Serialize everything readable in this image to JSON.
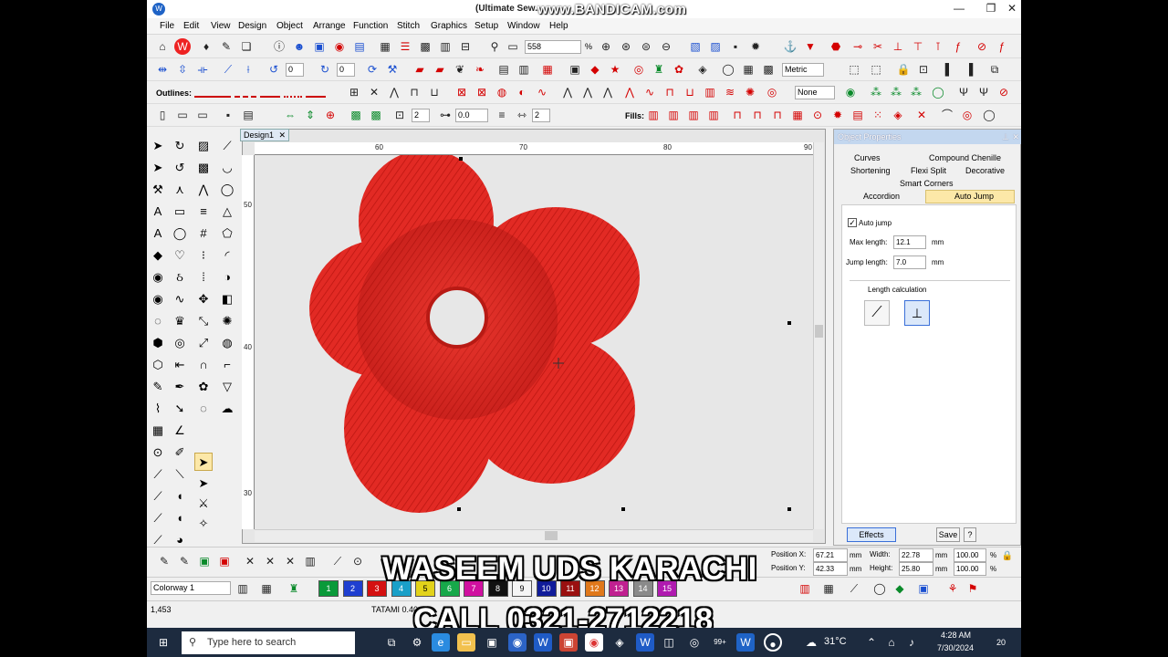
{
  "window": {
    "title": "(Ultimate Sew...",
    "watermark": "www.BANDICAM.com",
    "minimize": "—",
    "restore": "❐",
    "close": "✕"
  },
  "menu": [
    "File",
    "Edit",
    "View",
    "Design",
    "Object",
    "Arrange",
    "Function",
    "Stitch",
    "Graphics",
    "Setup",
    "Window",
    "Help"
  ],
  "toolbar": {
    "zoom_value": "558",
    "zoom_unit": "%",
    "units": "Metric",
    "outlines_label": "Outlines:",
    "fills_label": "Fills:",
    "none_label": "None",
    "spin1": "0",
    "spin2": "0",
    "spin3": "2",
    "spin4": "0.0",
    "spin5": "2"
  },
  "document": {
    "tab_label": "Design1",
    "ruler_top": [
      "60",
      "70",
      "80",
      "90"
    ],
    "ruler_left": [
      "50",
      "40",
      "30"
    ]
  },
  "panel": {
    "title": "Object Properties",
    "tabs": [
      "Curves",
      "Compound Chenille",
      "Shortening",
      "Flexi Split",
      "Decorative",
      "Smart Corners",
      "Accordion",
      "Auto Jump"
    ],
    "active_tab": "Auto Jump",
    "auto_jump_label": "Auto jump",
    "auto_jump_checked": true,
    "max_length_label": "Max length:",
    "max_length_value": "12.1",
    "jump_length_label": "Jump length:",
    "jump_length_value": "7.0",
    "unit": "mm",
    "length_calc_label": "Length calculation",
    "effects_button": "Effects",
    "save_button": "Save",
    "help_button": "?"
  },
  "position": {
    "pos_x_label": "Position X:",
    "pos_x": "67.21",
    "pos_y_label": "Position Y:",
    "pos_y": "42.33",
    "width_label": "Width:",
    "width": "22.78",
    "height_label": "Height:",
    "height": "25.80",
    "unit": "mm",
    "scale_w": "100.00",
    "scale_h": "100.00",
    "pct": "%"
  },
  "colorway": {
    "label": "Colorway 1",
    "swatches": [
      {
        "num": "1",
        "color": "#0a9a3a"
      },
      {
        "num": "2",
        "color": "#1f3fd0"
      },
      {
        "num": "3",
        "color": "#d41010"
      },
      {
        "num": "4",
        "color": "#1aa0c8"
      },
      {
        "num": "5",
        "color": "#e2d21a"
      },
      {
        "num": "6",
        "color": "#17a84a"
      },
      {
        "num": "7",
        "color": "#d010a0"
      },
      {
        "num": "8",
        "color": "#111111"
      },
      {
        "num": "9",
        "color": "#f5f5f5"
      },
      {
        "num": "10",
        "color": "#101c9a"
      },
      {
        "num": "11",
        "color": "#9a1010"
      },
      {
        "num": "12",
        "color": "#e0781a"
      },
      {
        "num": "13",
        "color": "#c02090"
      },
      {
        "num": "14",
        "color": "#8a8a8a"
      },
      {
        "num": "15",
        "color": "#b01ab0"
      }
    ]
  },
  "status": {
    "stitch_count": "1,453",
    "stitch_type": "TATAMI  0.40 mm"
  },
  "overlay": {
    "line1": "WASEEM UDS KARACHI",
    "line2": "CALL 0321-2712218"
  },
  "taskbar": {
    "search_placeholder": "Type here to search",
    "weather": "31°C",
    "time": "4:28 AM",
    "date": "7/30/2024",
    "badge": "99+",
    "notifications": "20"
  },
  "colors": {
    "flower": "#e02323",
    "accent_yellow": "#fce8a8"
  }
}
